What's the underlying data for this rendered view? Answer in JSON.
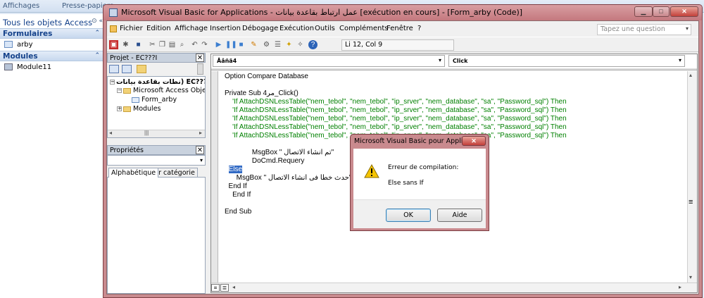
{
  "access": {
    "ribbon_groups": [
      "Affichages",
      "Presse-papiers"
    ],
    "nav_header": "Tous les objets Access",
    "groups": [
      {
        "label": "Formulaires",
        "items": [
          "arby"
        ]
      },
      {
        "label": "Modules",
        "items": [
          "Module11"
        ]
      }
    ]
  },
  "vba": {
    "title": "Microsoft Visual Basic for Applications - عمل ارتباط بقاعدة بيانات [exécution en cours] - [Form_arby (Code)]",
    "menu": [
      "Fichier",
      "Edition",
      "Affichage",
      "Insertion",
      "Débogage",
      "Exécution",
      "Outils",
      "Compléments",
      "Fenêtre",
      "?"
    ],
    "help_placeholder": "Tapez une question",
    "cursor_position": "Li 12, Col 9",
    "project": {
      "title": "Projet - EC???I",
      "root": "نطات بقاعدة بيانات) EC???I",
      "nodes": [
        "Microsoft Access Objets",
        "Form_arby",
        "Modules"
      ]
    },
    "properties": {
      "title": "Propriétés",
      "tabs": [
        "Alphabétique",
        "Par catégorie"
      ]
    },
    "code": {
      "object_combo": "Åâñä4",
      "procedure_combo": "Click",
      "lines": [
        {
          "text": "Option Compare Database",
          "style": "plain"
        },
        {
          "text": "",
          "style": "plain"
        },
        {
          "text": "Private Sub مر4_Click()",
          "style": "plain"
        },
        {
          "text": "    'If AttachDSNLessTable(\"nem_tebol\", \"nem_tebol\", \"ip_srver\", \"nem_database\", \"sa\", \"Password_sql\") Then",
          "style": "comment"
        },
        {
          "text": "    'If AttachDSNLessTable(\"nem_tebol\", \"nem_tebol\", \"ip_srver\", \"nem_database\", \"sa\", \"Password_sql\") Then",
          "style": "comment"
        },
        {
          "text": "    'If AttachDSNLessTable(\"nem_tebol\", \"nem_tebol\", \"ip_srver\", \"nem_database\", \"sa\", \"Password_sql\") Then",
          "style": "comment"
        },
        {
          "text": "    'If AttachDSNLessTable(\"nem_tebol\", \"nem_tebol\", \"ip_srver\", \"nem_database\", \"sa\", \"Password_sql\") Then",
          "style": "comment"
        },
        {
          "text": "    'If AttachDSNLessTable(\"nem_tebol\", \"nem_tebol\", \"ip_srver\", \"nem_database\", \"sa\", \"Password_sql\") Then",
          "style": "comment"
        },
        {
          "text": "",
          "style": "plain"
        },
        {
          "text": "              MsgBox \" تم انشاء الاتصال\"",
          "style": "plain"
        },
        {
          "text": "              DoCmd.Requery",
          "style": "plain"
        },
        {
          "text": "  Else",
          "style": "selected"
        },
        {
          "text": "      MsgBox \" حدث خطا فى انشاء الاتصال\"",
          "style": "plain"
        },
        {
          "text": "  End If",
          "style": "plain"
        },
        {
          "text": "    End If",
          "style": "plain"
        },
        {
          "text": "",
          "style": "plain"
        },
        {
          "text": "End Sub",
          "style": "plain"
        }
      ]
    }
  },
  "dialog": {
    "title": "Microsoft Visual Basic pour Applicati...",
    "message_line1": "Erreur de compilation:",
    "message_line2": "Else sans If",
    "ok_label": "OK",
    "help_label": "Aide"
  },
  "colors": {
    "keyword": "#00008b",
    "comment": "#008000",
    "selection": "#316ac5",
    "window_frame": "#c98a8e"
  }
}
